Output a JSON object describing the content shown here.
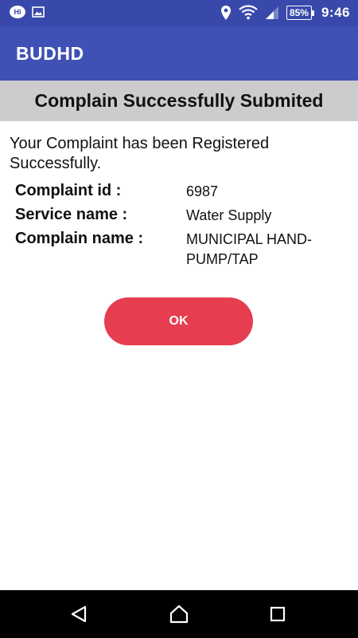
{
  "status_bar": {
    "notification_icons": [
      "hi-messenger-icon",
      "image-icon"
    ],
    "system_icons": [
      "location-icon",
      "wifi-icon",
      "cell-signal-icon"
    ],
    "battery_percent": "85%",
    "time": "9:46"
  },
  "app_bar": {
    "title": "BUDHD"
  },
  "subheader": {
    "title": "Complain Successfully Submited"
  },
  "message": "Your Complaint has been Registered Successfully.",
  "details": [
    {
      "label": "Complaint id :",
      "value": "6987"
    },
    {
      "label": "Service name :",
      "value": "Water Supply"
    },
    {
      "label": "Complain name :",
      "value": "MUNICIPAL HAND-PUMP/TAP"
    }
  ],
  "ok_button": {
    "label": "OK"
  },
  "nav_bar": {
    "buttons": [
      "back-icon",
      "home-icon",
      "recents-icon"
    ]
  },
  "colors": {
    "status_bar": "#3949ab",
    "app_bar": "#3f51b5",
    "subheader_bg": "#cccccc",
    "ok_button": "#e63d4f",
    "nav_bar": "#000000"
  }
}
